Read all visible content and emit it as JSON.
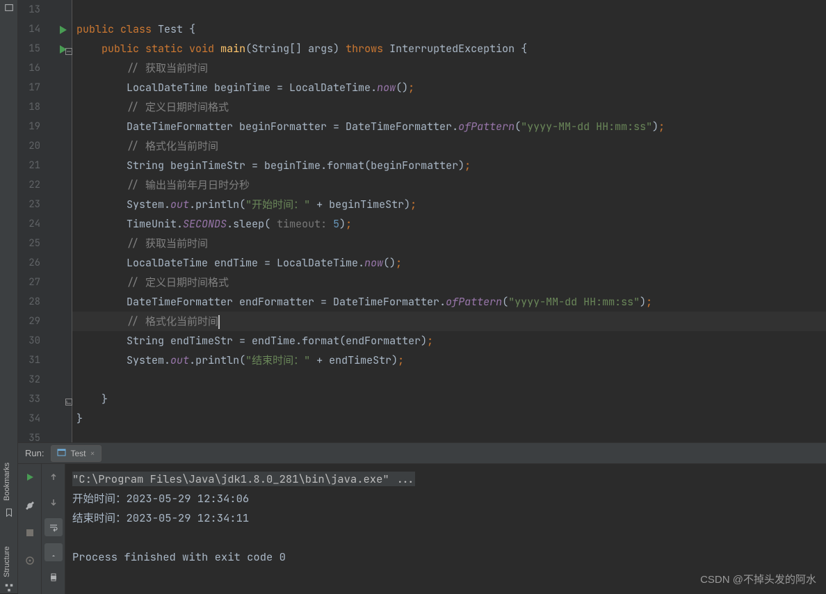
{
  "sidebar": {
    "bookmarks": "Bookmarks",
    "structure": "Structure"
  },
  "code": {
    "lines": [
      {
        "n": 13,
        "indent": "",
        "tokens": []
      },
      {
        "n": 14,
        "run": true,
        "indent": "",
        "tokens": [
          {
            "t": "kw",
            "v": "public "
          },
          {
            "t": "kw",
            "v": "class "
          },
          {
            "t": "cls",
            "v": "Test "
          },
          {
            "t": "pun",
            "v": "{"
          }
        ]
      },
      {
        "n": 15,
        "run": true,
        "fold": "open",
        "indent": "    ",
        "tokens": [
          {
            "t": "kw",
            "v": "public "
          },
          {
            "t": "kw",
            "v": "static "
          },
          {
            "t": "kw",
            "v": "void "
          },
          {
            "t": "mth",
            "v": "main"
          },
          {
            "t": "pun",
            "v": "("
          },
          {
            "t": "cls",
            "v": "String"
          },
          {
            "t": "pun",
            "v": "[] "
          },
          {
            "t": "cls",
            "v": "args"
          },
          {
            "t": "pun",
            "v": ") "
          },
          {
            "t": "kw",
            "v": "throws "
          },
          {
            "t": "cls",
            "v": "InterruptedException "
          },
          {
            "t": "pun",
            "v": "{"
          }
        ]
      },
      {
        "n": 16,
        "indent": "        ",
        "tokens": [
          {
            "t": "cmt",
            "v": "// 获取当前时间"
          }
        ]
      },
      {
        "n": 17,
        "indent": "        ",
        "tokens": [
          {
            "t": "cls",
            "v": "LocalDateTime beginTime "
          },
          {
            "t": "pun",
            "v": "= "
          },
          {
            "t": "cls",
            "v": "LocalDateTime"
          },
          {
            "t": "pun",
            "v": "."
          },
          {
            "t": "statc",
            "v": "now"
          },
          {
            "t": "pun",
            "v": "()"
          },
          {
            "t": "pun-o",
            "v": ";"
          }
        ]
      },
      {
        "n": 18,
        "indent": "        ",
        "tokens": [
          {
            "t": "cmt",
            "v": "// 定义日期时间格式"
          }
        ]
      },
      {
        "n": 19,
        "indent": "        ",
        "tokens": [
          {
            "t": "cls",
            "v": "DateTimeFormatter beginFormatter "
          },
          {
            "t": "pun",
            "v": "= "
          },
          {
            "t": "cls",
            "v": "DateTimeFormatter"
          },
          {
            "t": "pun",
            "v": "."
          },
          {
            "t": "statc",
            "v": "ofPattern"
          },
          {
            "t": "pun",
            "v": "("
          },
          {
            "t": "str",
            "v": "\"yyyy-MM-dd HH:mm:ss\""
          },
          {
            "t": "pun",
            "v": ")"
          },
          {
            "t": "pun-o",
            "v": ";"
          }
        ]
      },
      {
        "n": 20,
        "indent": "        ",
        "tokens": [
          {
            "t": "cmt",
            "v": "// 格式化当前时间"
          }
        ]
      },
      {
        "n": 21,
        "indent": "        ",
        "tokens": [
          {
            "t": "cls",
            "v": "String beginTimeStr "
          },
          {
            "t": "pun",
            "v": "= "
          },
          {
            "t": "cls",
            "v": "beginTime"
          },
          {
            "t": "pun",
            "v": "."
          },
          {
            "t": "cls",
            "v": "format"
          },
          {
            "t": "pun",
            "v": "("
          },
          {
            "t": "cls",
            "v": "beginFormatter"
          },
          {
            "t": "pun",
            "v": ")"
          },
          {
            "t": "pun-o",
            "v": ";"
          }
        ]
      },
      {
        "n": 22,
        "indent": "        ",
        "tokens": [
          {
            "t": "cmt",
            "v": "// 输出当前年月日时分秒"
          }
        ]
      },
      {
        "n": 23,
        "indent": "        ",
        "tokens": [
          {
            "t": "cls",
            "v": "System"
          },
          {
            "t": "pun",
            "v": "."
          },
          {
            "t": "stat",
            "v": "out"
          },
          {
            "t": "pun",
            "v": "."
          },
          {
            "t": "cls",
            "v": "println"
          },
          {
            "t": "pun",
            "v": "("
          },
          {
            "t": "str",
            "v": "\"开始时间：\""
          },
          {
            "t": "pun",
            "v": " + "
          },
          {
            "t": "cls",
            "v": "beginTimeStr"
          },
          {
            "t": "pun",
            "v": ")"
          },
          {
            "t": "pun-o",
            "v": ";"
          }
        ]
      },
      {
        "n": 24,
        "indent": "        ",
        "tokens": [
          {
            "t": "cls",
            "v": "TimeUnit"
          },
          {
            "t": "pun",
            "v": "."
          },
          {
            "t": "stat",
            "v": "SECONDS"
          },
          {
            "t": "pun",
            "v": "."
          },
          {
            "t": "cls",
            "v": "sleep"
          },
          {
            "t": "pun",
            "v": "( "
          },
          {
            "t": "hint",
            "v": "timeout: "
          },
          {
            "t": "num",
            "v": "5"
          },
          {
            "t": "pun",
            "v": ")"
          },
          {
            "t": "pun-o",
            "v": ";"
          }
        ]
      },
      {
        "n": 25,
        "indent": "        ",
        "tokens": [
          {
            "t": "cmt",
            "v": "// 获取当前时间"
          }
        ]
      },
      {
        "n": 26,
        "indent": "        ",
        "tokens": [
          {
            "t": "cls",
            "v": "LocalDateTime endTime "
          },
          {
            "t": "pun",
            "v": "= "
          },
          {
            "t": "cls",
            "v": "LocalDateTime"
          },
          {
            "t": "pun",
            "v": "."
          },
          {
            "t": "statc",
            "v": "now"
          },
          {
            "t": "pun",
            "v": "()"
          },
          {
            "t": "pun-o",
            "v": ";"
          }
        ]
      },
      {
        "n": 27,
        "indent": "        ",
        "tokens": [
          {
            "t": "cmt",
            "v": "// 定义日期时间格式"
          }
        ]
      },
      {
        "n": 28,
        "indent": "        ",
        "tokens": [
          {
            "t": "cls",
            "v": "DateTimeFormatter endFormatter "
          },
          {
            "t": "pun",
            "v": "= "
          },
          {
            "t": "cls",
            "v": "DateTimeFormatter"
          },
          {
            "t": "pun",
            "v": "."
          },
          {
            "t": "statc",
            "v": "ofPattern"
          },
          {
            "t": "pun",
            "v": "("
          },
          {
            "t": "str",
            "v": "\"yyyy-MM-dd HH:mm:ss\""
          },
          {
            "t": "pun",
            "v": ")"
          },
          {
            "t": "pun-o",
            "v": ";"
          }
        ]
      },
      {
        "n": 29,
        "hl": true,
        "caret": true,
        "indent": "        ",
        "tokens": [
          {
            "t": "cmt",
            "v": "// 格式化当前时间"
          }
        ]
      },
      {
        "n": 30,
        "indent": "        ",
        "tokens": [
          {
            "t": "cls",
            "v": "String endTimeStr "
          },
          {
            "t": "pun",
            "v": "= "
          },
          {
            "t": "cls",
            "v": "endTime"
          },
          {
            "t": "pun",
            "v": "."
          },
          {
            "t": "cls",
            "v": "format"
          },
          {
            "t": "pun",
            "v": "("
          },
          {
            "t": "cls",
            "v": "endFormatter"
          },
          {
            "t": "pun",
            "v": ")"
          },
          {
            "t": "pun-o",
            "v": ";"
          }
        ]
      },
      {
        "n": 31,
        "indent": "        ",
        "tokens": [
          {
            "t": "cls",
            "v": "System"
          },
          {
            "t": "pun",
            "v": "."
          },
          {
            "t": "stat",
            "v": "out"
          },
          {
            "t": "pun",
            "v": "."
          },
          {
            "t": "cls",
            "v": "println"
          },
          {
            "t": "pun",
            "v": "("
          },
          {
            "t": "str",
            "v": "\"结束时间：\""
          },
          {
            "t": "pun",
            "v": " + "
          },
          {
            "t": "cls",
            "v": "endTimeStr"
          },
          {
            "t": "pun",
            "v": ")"
          },
          {
            "t": "pun-o",
            "v": ";"
          }
        ]
      },
      {
        "n": 32,
        "indent": "",
        "tokens": []
      },
      {
        "n": 33,
        "fold": "close",
        "indent": "    ",
        "tokens": [
          {
            "t": "pun",
            "v": "}"
          }
        ]
      },
      {
        "n": 34,
        "indent": "",
        "tokens": [
          {
            "t": "pun",
            "v": "}"
          }
        ]
      },
      {
        "n": 35,
        "indent": "",
        "tokens": []
      }
    ]
  },
  "run": {
    "label": "Run:",
    "tab": "Test",
    "cmd": "\"C:\\Program Files\\Java\\jdk1.8.0_281\\bin\\java.exe\" ...",
    "out1": "开始时间：2023-05-29 12:34:06",
    "out2": "结束时间：2023-05-29 12:34:11",
    "exit": "Process finished with exit code 0"
  },
  "watermark": "CSDN @不掉头发的阿水"
}
